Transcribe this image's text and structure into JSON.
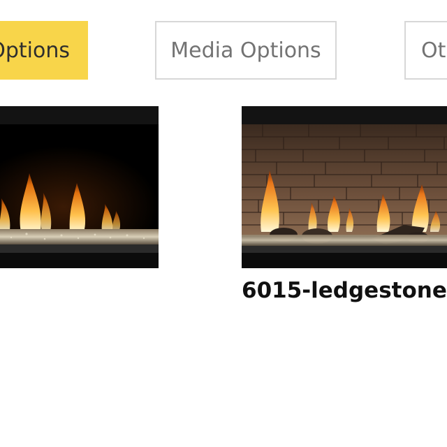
{
  "tabs": [
    {
      "label": "Options",
      "state": "active"
    },
    {
      "label": "Media Options",
      "state": "inactive"
    },
    {
      "label": "Ot",
      "state": "inactive"
    }
  ],
  "gallery": [
    {
      "image": "fireplace-crystal-media-photo",
      "caption": ""
    },
    {
      "image": "fireplace-ledgestone-photo",
      "caption": "6015-ledgestone"
    }
  ],
  "colors": {
    "active_tab": "#f8d54a",
    "tab_border": "#d7d7d7",
    "tab_text": "#737373"
  }
}
